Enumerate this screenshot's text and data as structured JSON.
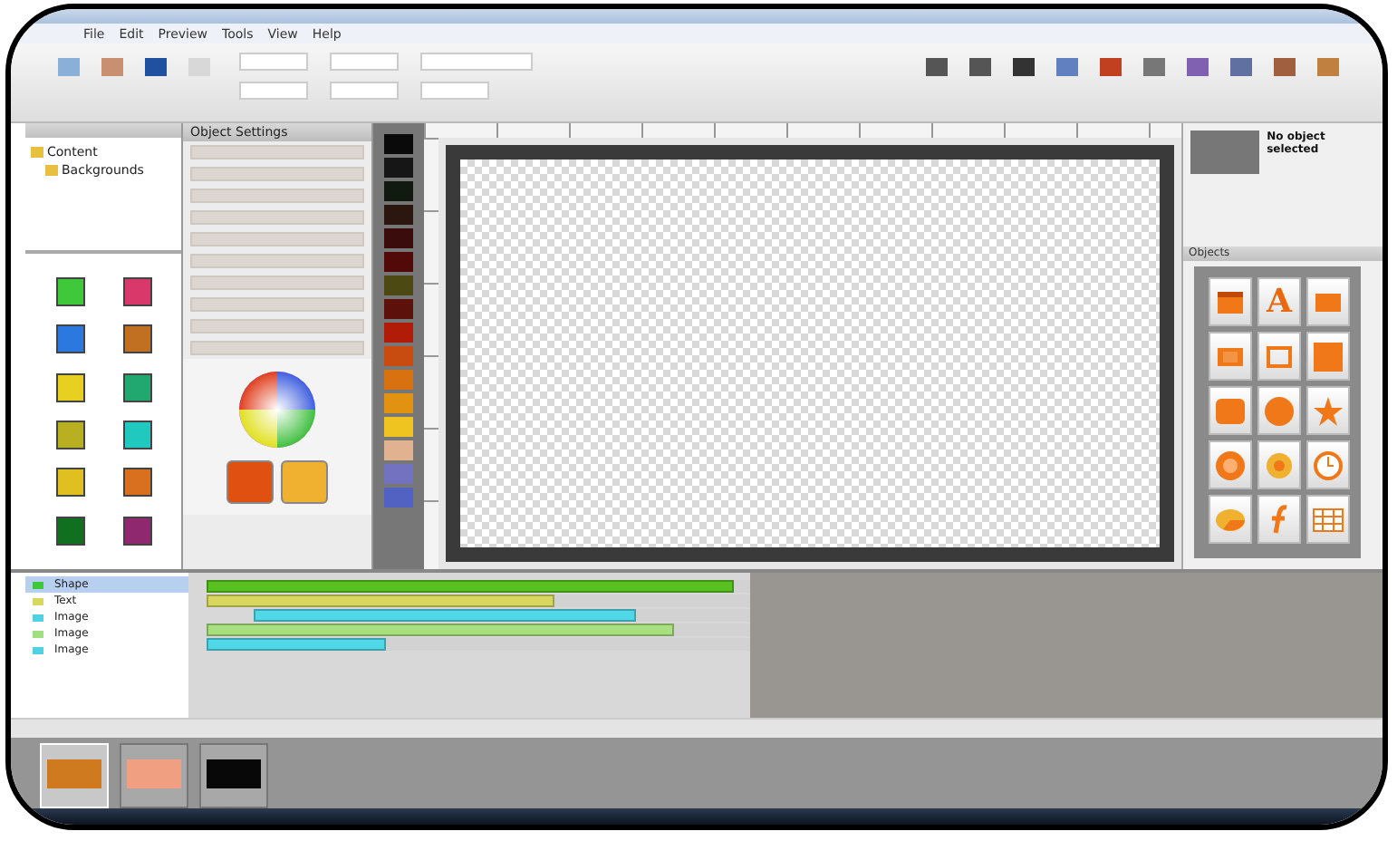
{
  "menu": [
    "File",
    "Edit",
    "Preview",
    "Tools",
    "View",
    "Help"
  ],
  "library": {
    "tree": [
      {
        "label": "Content",
        "children": [
          {
            "label": "Backgrounds"
          }
        ]
      }
    ],
    "thumbnails": [
      {
        "color": "#3ec83a"
      },
      {
        "color": "#d8386a"
      },
      {
        "color": "#2a78e0"
      },
      {
        "color": "#c07020"
      },
      {
        "color": "#e8d020"
      },
      {
        "color": "#20a870"
      },
      {
        "color": "#b8b020"
      },
      {
        "color": "#20c8c0"
      },
      {
        "color": "#e0c020"
      },
      {
        "color": "#d87020"
      },
      {
        "color": "#107020"
      },
      {
        "color": "#902870"
      }
    ]
  },
  "settings": {
    "title": "Object Settings"
  },
  "swatches": [
    {
      "color": "#0a0a0a"
    },
    {
      "color": "#161616"
    },
    {
      "color": "#101a10"
    },
    {
      "color": "#2c1610"
    },
    {
      "color": "#3a0c0c"
    },
    {
      "color": "#520a08"
    },
    {
      "color": "#4c4a12"
    },
    {
      "color": "#5c120a"
    },
    {
      "color": "#b01c08"
    },
    {
      "color": "#c84c10"
    },
    {
      "color": "#d87210"
    },
    {
      "color": "#e09210"
    },
    {
      "color": "#f0c420"
    },
    {
      "color": "#e0b290"
    },
    {
      "color": "#7272c0"
    },
    {
      "color": "#5262c2"
    }
  ],
  "current_colors": [
    {
      "color": "#e05010"
    },
    {
      "color": "#f0b030"
    }
  ],
  "preview": {
    "label": "No object selected"
  },
  "objects": {
    "title": "Objects",
    "items": [
      {
        "kind": "video"
      },
      {
        "kind": "text",
        "glyph": "A"
      },
      {
        "kind": "image"
      },
      {
        "kind": "gallery"
      },
      {
        "kind": "frame"
      },
      {
        "kind": "rectangle"
      },
      {
        "kind": "rounded"
      },
      {
        "kind": "circle"
      },
      {
        "kind": "star"
      },
      {
        "kind": "button"
      },
      {
        "kind": "puzzle"
      },
      {
        "kind": "clock"
      },
      {
        "kind": "chart"
      },
      {
        "kind": "flash"
      },
      {
        "kind": "table"
      }
    ]
  },
  "timeline": {
    "layers": [
      {
        "label": "Shape",
        "selected": true,
        "color": "#3ec83a"
      },
      {
        "label": "Text",
        "selected": false,
        "color": "#d8d860"
      },
      {
        "label": "Image",
        "selected": false,
        "color": "#50d0e0"
      },
      {
        "label": "Image",
        "selected": false,
        "color": "#a0e080"
      },
      {
        "label": "Image",
        "selected": false,
        "color": "#50d0e0"
      }
    ],
    "bars": [
      {
        "color": "#58c020",
        "level": 0.97
      },
      {
        "color": "#d8d860",
        "level": 0.64
      },
      {
        "color": "#50d8e8",
        "level": 0.77
      },
      {
        "color": "#a8e080",
        "level": 0.86
      },
      {
        "color": "#50d8e8",
        "level": 0.33
      }
    ]
  },
  "scenes": [
    {
      "color": "#d07a20",
      "selected": true
    },
    {
      "color": "#f0a080",
      "selected": false
    },
    {
      "color": "#080808",
      "selected": false
    }
  ]
}
